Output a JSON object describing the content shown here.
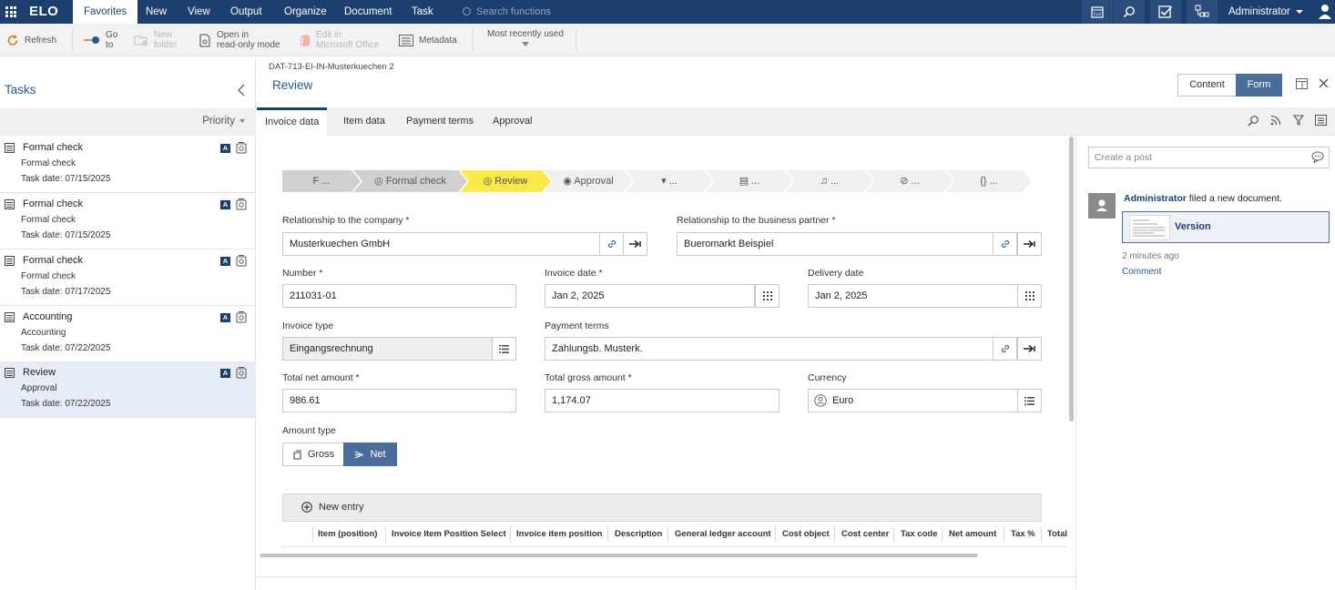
{
  "topbar": {
    "logo": "ELO",
    "menu": [
      "Favorites",
      "New",
      "View",
      "Output",
      "Organize",
      "Document",
      "Task"
    ],
    "active_menu": "Favorites",
    "search_placeholder": "Search functions",
    "user": "Administrator"
  },
  "toolbar": {
    "refresh": "Refresh",
    "goto_1": "Go",
    "goto_2": "to",
    "newfolder_1": "New",
    "newfolder_2": "folder",
    "openro_1": "Open in",
    "openro_2": "read-only mode",
    "editoffice_1": "Edit in",
    "editoffice_2": "Microsoft Office",
    "metadata": "Metadata",
    "recent": "Most recently used"
  },
  "tasks": {
    "title": "Tasks",
    "sort": "Priority",
    "items": [
      {
        "name": "Formal check",
        "sub": "Formal check",
        "date": "Task date: 07/15/2025",
        "badge": "A"
      },
      {
        "name": "Formal check",
        "sub": "Formal check",
        "date": "Task date: 07/15/2025",
        "badge": "A"
      },
      {
        "name": "Formal check",
        "sub": "Formal check",
        "date": "Task date: 07/17/2025",
        "badge": "A"
      },
      {
        "name": "Accounting",
        "sub": "Accounting",
        "date": "Task date: 07/22/2025",
        "badge": "A"
      },
      {
        "name": "Review",
        "sub": "Approval",
        "date": "Task date: 07/22/2025",
        "badge": "A"
      }
    ]
  },
  "document": {
    "path": "DAT-713-EI-IN-Musterkuechen 2",
    "title": "Review",
    "view_content": "Content",
    "view_form": "Form"
  },
  "tabs": [
    "Invoice data",
    "Item data",
    "Payment terms",
    "Approval"
  ],
  "workflow": [
    {
      "label": "F ...",
      "state": "done"
    },
    {
      "label": "Formal check",
      "state": "done"
    },
    {
      "label": "Review",
      "state": "current"
    },
    {
      "label": "Approval",
      "state": "pending"
    },
    {
      "label": "...",
      "state": "pending"
    },
    {
      "label": "...",
      "state": "pending"
    },
    {
      "label": "...",
      "state": "pending"
    },
    {
      "label": "...",
      "state": "pending"
    },
    {
      "label": "...",
      "state": "pending"
    }
  ],
  "form": {
    "rel_company_label": "Relationship to the company *",
    "rel_company_value": "Musterkuechen GmbH",
    "rel_partner_label": "Relationship to the business partner *",
    "rel_partner_value": "Bueromarkt Beispiel",
    "number_label": "Number *",
    "number_value": "211031-01",
    "invoice_date_label": "Invoice date *",
    "invoice_date_value": "Jan 2, 2025",
    "delivery_date_label": "Delivery date",
    "delivery_date_value": "Jan 2, 2025",
    "invoice_type_label": "Invoice type",
    "invoice_type_value": "Eingangsrechnung",
    "payment_terms_label": "Payment terms",
    "payment_terms_value": "Zahlungsb. Musterk.",
    "net_label": "Total net amount *",
    "net_value": "986.61",
    "gross_label": "Total gross amount *",
    "gross_value": "1,174.07",
    "currency_label": "Currency",
    "currency_value": "Euro",
    "amount_type_label": "Amount type",
    "amount_gross": "Gross",
    "amount_net": "Net",
    "amount_type_selected": "Net"
  },
  "grid": {
    "new_entry": "New entry",
    "columns": [
      "Item (position)",
      "Invoice Item Position Select",
      "Invoice item position",
      "Description",
      "General ledger account",
      "Cost object",
      "Cost center",
      "Tax code",
      "Net amount",
      "Tax %",
      "Total"
    ]
  },
  "feed": {
    "post_placeholder": "Create a post",
    "author": "Administrator",
    "action": " filed a new document.",
    "version": "Version",
    "time": "2 minutes ago",
    "comment": "Comment"
  },
  "colors": {
    "brand": "#1c3f6e",
    "accent": "#4a6d9a",
    "wf_done": "#d0d0d0",
    "wf_current": "#fbe84a",
    "wf_pending": "#f0f0f0"
  }
}
